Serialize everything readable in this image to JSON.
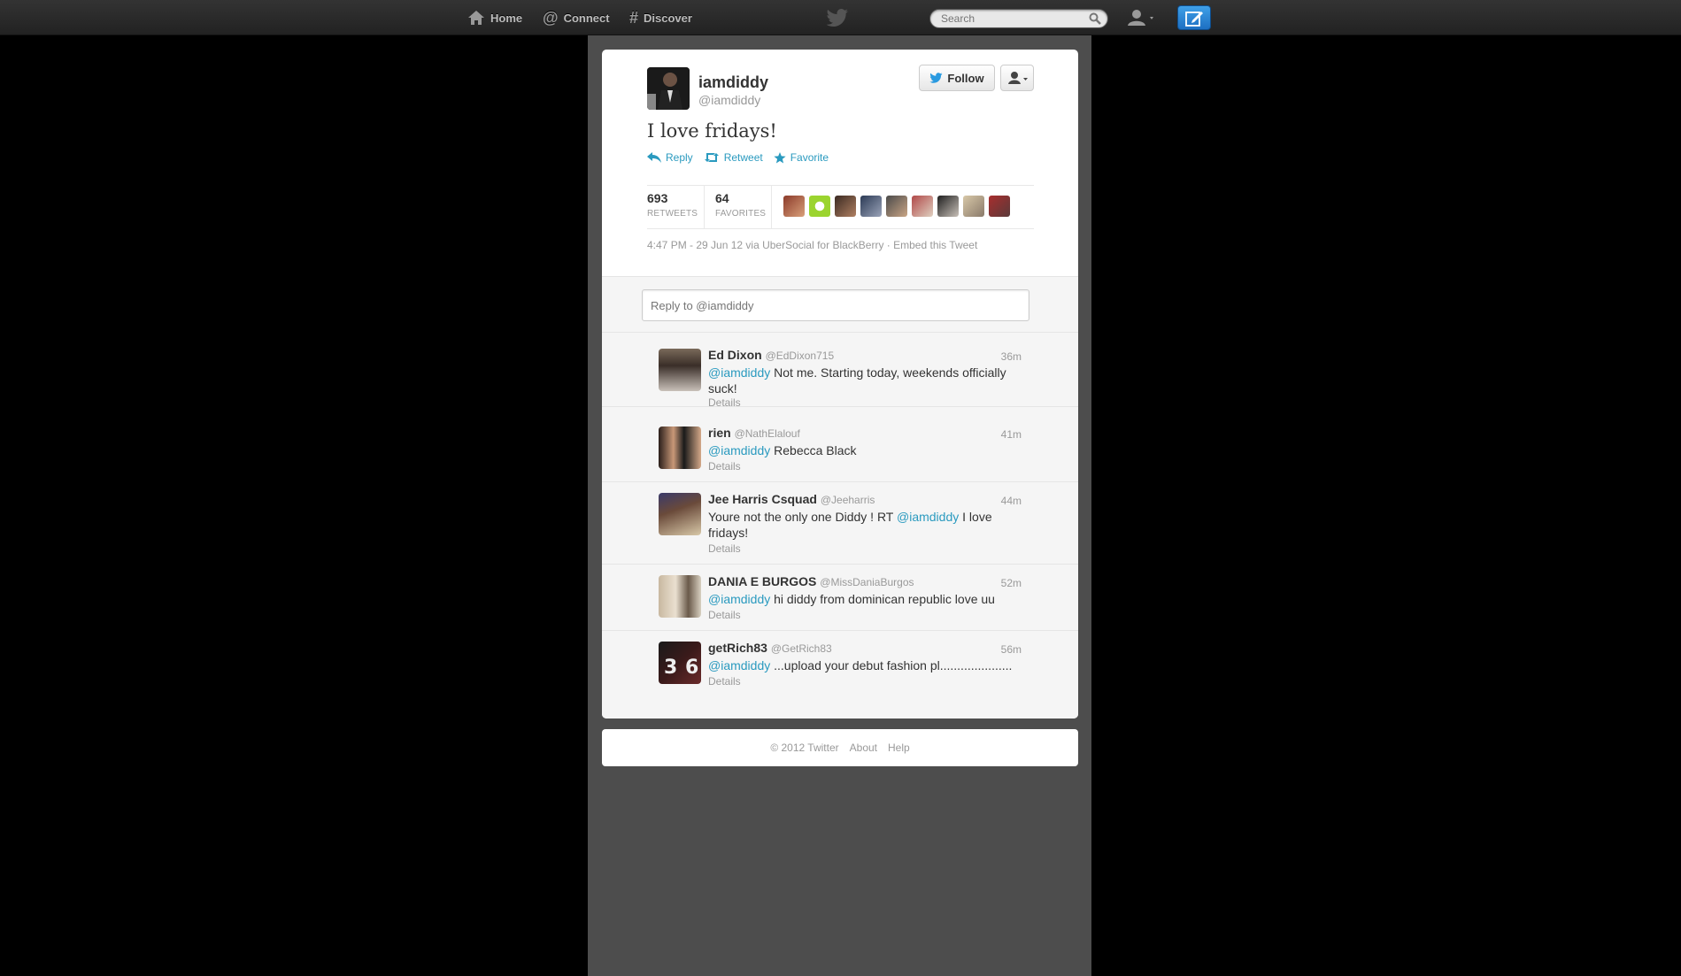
{
  "nav": {
    "home": "Home",
    "connect": "Connect",
    "discover": "Discover",
    "search_placeholder": "Search"
  },
  "tweet": {
    "author_name": "iamdiddy",
    "author_handle": "@iamdiddy",
    "follow_label": "Follow",
    "text": "I love fridays!",
    "reply_label": "Reply",
    "retweet_label": "Retweet",
    "favorite_label": "Favorite",
    "retweets_count": "693",
    "retweets_label": "RETWEETS",
    "favorites_count": "64",
    "favorites_label": "FAVORITES",
    "timestamp": "4:47 PM - 29 Jun 12 via UberSocial for BlackBerry",
    "separator": " · ",
    "embed_label": "Embed this Tweet"
  },
  "reply_box": {
    "placeholder": "Reply to @iamdiddy"
  },
  "replies": [
    {
      "name": "Ed Dixon",
      "handle": "@EdDixon715",
      "time": "36m",
      "mention": "@iamdiddy",
      "text": " Not me. Starting today, weekends officially suck!",
      "details": "Details"
    },
    {
      "name": "rien",
      "handle": "@NathElalouf",
      "time": "41m",
      "mention": "@iamdiddy",
      "text": " Rebecca Black",
      "details": "Details"
    },
    {
      "name": "Jee Harris Csquad",
      "handle": "@Jeeharris",
      "time": "44m",
      "pre": "Youre not the only one Diddy ! RT ",
      "mention": "@iamdiddy",
      "text": " I love fridays!",
      "details": "Details"
    },
    {
      "name": "DANIA E BURGOS",
      "handle": "@MissDaniaBurgos",
      "time": "52m",
      "mention": "@iamdiddy",
      "text": " hi diddy from dominican republic love uu",
      "details": "Details"
    },
    {
      "name": "getRich83",
      "handle": "@GetRich83",
      "time": "56m",
      "mention": "@iamdiddy",
      "text": " ...upload your debut fashion pl.....................",
      "details": "Details"
    }
  ],
  "footer": {
    "copyright": "© 2012 Twitter",
    "about": "About",
    "help": "Help"
  },
  "colors": {
    "link": "#2a9abf",
    "compose": "#1d6fc2",
    "column": "#4d4d4d"
  }
}
